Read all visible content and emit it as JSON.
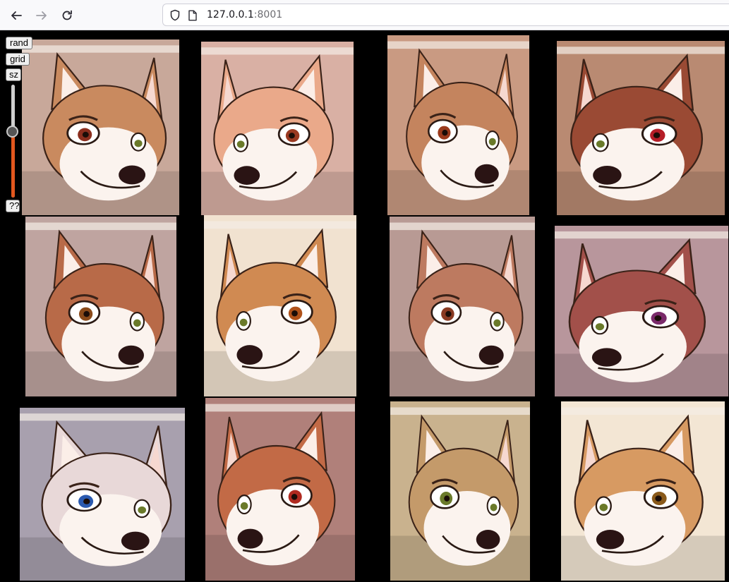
{
  "browser": {
    "url_host": "127.0.0.1",
    "url_port": ":8001"
  },
  "controls": {
    "rand_label": "rand",
    "grid_label": "grid",
    "size_label": "sz",
    "help_label": "??",
    "size_slider_level": 0.27
  },
  "colors": {
    "slider_fill": "#e2571e",
    "page_background": "#000000"
  },
  "gallery": {
    "rows": 3,
    "columns": 4,
    "images": [
      {
        "bg": "#c8a89a",
        "fur": "#c98a5f",
        "eye": "#8b2e1e"
      },
      {
        "bg": "#d9b0a4",
        "fur": "#eaa98a",
        "eye": "#9a3a22"
      },
      {
        "bg": "#c99a82",
        "fur": "#c4845e",
        "eye": "#9a3a1c"
      },
      {
        "bg": "#b98a72",
        "fur": "#9a4a34",
        "eye": "#b51e28"
      },
      {
        "bg": "#bfa4a0",
        "fur": "#b86a48",
        "eye": "#8a4a1a"
      },
      {
        "bg": "#f1e2d0",
        "fur": "#d08a52",
        "eye": "#b0521a"
      },
      {
        "bg": "#b89a94",
        "fur": "#bd7a60",
        "eye": "#8a3a22"
      },
      {
        "bg": "#b8969c",
        "fur": "#a2504a",
        "eye": "#7a2a6a"
      },
      {
        "bg": "#a8a0ae",
        "fur": "#e8d8d8",
        "eye": "#2a5ab0"
      },
      {
        "bg": "#b0807a",
        "fur": "#c26a46",
        "eye": "#b02a20"
      },
      {
        "bg": "#c9b28e",
        "fur": "#c49a6a",
        "eye": "#6a7a2a"
      },
      {
        "bg": "#f3e6d4",
        "fur": "#d79a62",
        "eye": "#8a5a1a"
      }
    ]
  }
}
